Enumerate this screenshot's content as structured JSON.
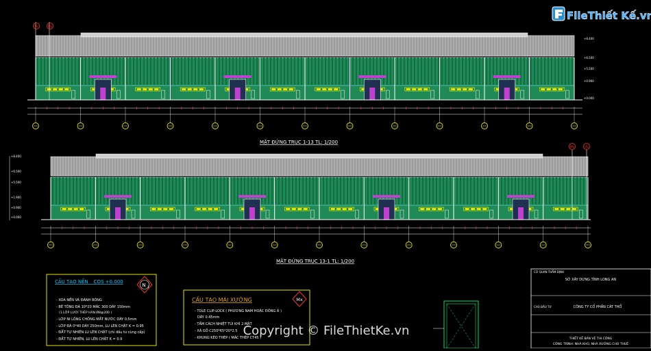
{
  "logo": {
    "text": "FileThiết Kế.vn"
  },
  "watermark": {
    "text": "Copyright © FileThietKe.vn"
  },
  "elevation_top": {
    "title": "MẶT ĐỨNG TRỤC 1-13   TL: 1/200",
    "markers": [
      "Vk",
      "Mx"
    ],
    "level_labels": [
      "+8.400",
      "+6.500",
      "+5.500",
      "+0.900",
      "+0.000"
    ]
  },
  "elevation_bottom": {
    "title": "MẶT ĐỨNG TRỤC 13-1   TL: 1/200",
    "markers": [
      "Mx",
      "Vk"
    ],
    "level_labels": [
      "+8.400",
      "+6.500",
      "+5.500",
      "+1.900",
      "+0.900",
      "+0.000"
    ]
  },
  "note_floor": {
    "title": "CẤU TẠO NỀN _ COS +0.000",
    "tag": "N",
    "tag_sub": "1",
    "lines": [
      "- XOA NỀN VÀ ĐÁNH BÓNG",
      "- BÊ TÔNG ĐÁ 10*20 MÁC 300 DÀY 150mm",
      "(1 LỚP LƯỚI THÉP HÀN Ø8@200 )",
      "- LỚP NI LÔNG CHỐNG MẤT NƯỚC DÀY 0.5mm",
      "- LỚP ĐÁ 0*40 DÀY 250mm, LU LÈN CHẶT K = 0.95",
      "- ĐẤT TỰ NHIÊN LU LÈN CHẶT (chỉ đầu tư cùng cấp)",
      "- ĐẤT TỰ NHIÊN, LU LÈN CHẶT K = 0.9"
    ]
  },
  "note_roof": {
    "title": "CẤU TẠO MÁI XƯỞNG",
    "tag": "Mx",
    "lines": [
      "- TOLE CLIP-LOCK ( PHƯƠNG NAM HOẶC ĐÔNG Á )",
      "DÀY 0.45mm",
      "- TẤM CÁCH NHIỆT TÚI KHÍ 2 MẶT",
      "- XÀ GỒ C250*65*20*2.5",
      "- KHUNG KÈO THÉP ( MÁC THÉP CT45 )"
    ]
  },
  "title_block": {
    "line1": "CƠ QUAN THẨM ĐỊNH",
    "line2": "SỞ XÂY DỰNG TỈNH LONG AN",
    "line3": "CHỦ ĐẦU TƯ",
    "line4": "CÔNG TY CỔ PHẦN CÁT THỔ",
    "line5": "THIẾT KẾ BẢN VẼ THI CÔNG",
    "line6": "CÔNG TRÌNH: NHÀ KHO, NHÀ XƯỞNG CHO THUÊ"
  },
  "colors": {
    "roof": "#bfbfbf",
    "wall_green": "#1f8a55",
    "wall_stripe": "#0a5a35",
    "door_magenta": "#c040d0",
    "window_yellow": "#e6e600",
    "note_border": "#e6e600",
    "note_title": "#00c8ff",
    "tag_red": "#ff3030"
  }
}
